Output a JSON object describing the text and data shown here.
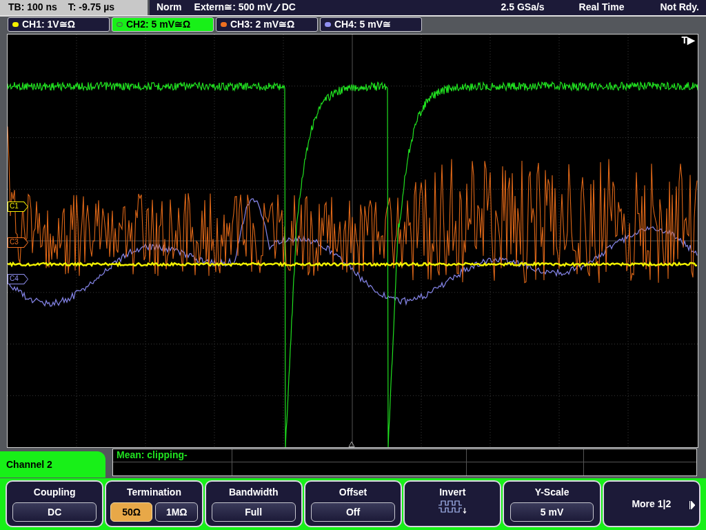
{
  "status_bar": {
    "timebase": "TB: 100 ns",
    "trigger_time": "T: -9.75 µs",
    "mode": "Norm",
    "trigger_source": "Extern≅: 500 mV",
    "trigger_coupling": "DC",
    "sample_rate": "2.5 GSa/s",
    "acquisition": "Real Time",
    "state": "Not Rdy."
  },
  "channel_tabs": [
    {
      "label": "CH1: 1V≅Ω",
      "color": "#f5f000",
      "selected": false
    },
    {
      "label": "CH2: 5 mV≅Ω",
      "color": "#20e020",
      "selected": true
    },
    {
      "label": "CH3: 2 mV≅Ω",
      "color": "#f07020",
      "selected": false
    },
    {
      "label": "CH4: 5 mV≅",
      "color": "#9090f0",
      "selected": false
    }
  ],
  "plot": {
    "trigger_label": "T▶",
    "markers": [
      {
        "label": "C1",
        "color": "#f5f000"
      },
      {
        "label": "C3",
        "color": "#f07020"
      },
      {
        "label": "C4",
        "color": "#9090f0"
      }
    ]
  },
  "measurement": {
    "text": "Mean: clipping-"
  },
  "menu": {
    "title": "Channel 2",
    "softkeys": [
      {
        "kind": "value",
        "label": "Coupling",
        "value": "DC"
      },
      {
        "kind": "options",
        "label": "Termination",
        "options": [
          {
            "label": "50Ω",
            "selected": true
          },
          {
            "label": "1MΩ",
            "selected": false
          }
        ]
      },
      {
        "kind": "value",
        "label": "Bandwidth",
        "value": "Full"
      },
      {
        "kind": "value",
        "label": "Offset",
        "value": "Off"
      },
      {
        "kind": "icon",
        "label": "Invert"
      },
      {
        "kind": "value",
        "label": "Y-Scale",
        "value": "5 mV"
      },
      {
        "kind": "more",
        "label": "More 1|2"
      }
    ]
  }
}
